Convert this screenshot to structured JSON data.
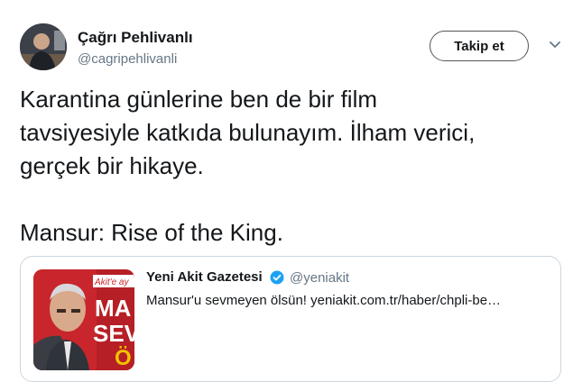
{
  "author": {
    "name": "Çağrı Pehlivanlı",
    "handle": "@cagripehlivanli"
  },
  "follow_button": {
    "label": "Takip et"
  },
  "tweet": {
    "text": "Karantina günlerine ben de bir film\ntavsiyesiyle katkıda bulunayım. İlham verici,\ngerçek bir hikaye.\n\nMansur: Rise of the King."
  },
  "quoted": {
    "name": "Yeni Akit Gazetesi",
    "handle": "@yeniakit",
    "text": "Mansur'u sevmeyen ölsün! yeniakit.com.tr/haber/chpli-be…",
    "thumbnail_text": {
      "tag": "Akit'e ay",
      "line1": "MA",
      "line2": "SEV",
      "line3": "Ö"
    }
  },
  "colors": {
    "text": "#14171a",
    "secondary": "#657786",
    "verified": "#1da1f2",
    "thumbnail_red": "#c8262c"
  },
  "icons": [
    "chevron-down-icon",
    "verified-badge-icon"
  ]
}
